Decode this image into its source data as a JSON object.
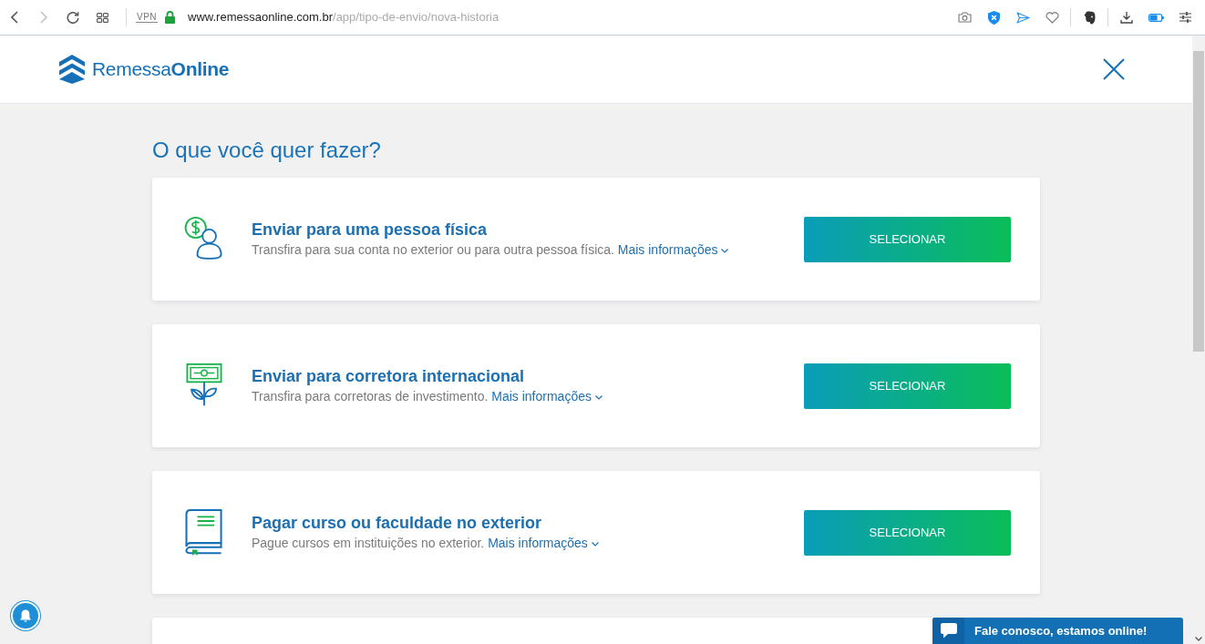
{
  "browser": {
    "forward_disabled": true,
    "vpn": "VPN",
    "url": {
      "host": "www.remessaonline.com.br",
      "path": "/app/tipo-de-envio/nova-historia"
    }
  },
  "header": {
    "logo": "Remessa**Online**"
  },
  "heading": "O que você quer fazer?",
  "options": [
    {
      "kind": "person",
      "title": "Enviar para uma pessoa física",
      "description": "Transfira para sua conta no exterior ou para outra pessoa física.",
      "link": "Mais informações",
      "button": "SELECIONAR"
    },
    {
      "kind": "plant",
      "title": "Enviar para corretora internacional",
      "description": "Transfira para corretoras de investimento.",
      "link": "Mais informações",
      "button": "SELECIONAR"
    },
    {
      "kind": "book",
      "title": "Pagar curso ou faculdade no exterior",
      "description": "Pague cursos em instituições no exterior.",
      "link": "Mais informações",
      "button": "SELECIONAR"
    }
  ],
  "chat": {
    "label": "Fale conosco, estamos online!"
  }
}
